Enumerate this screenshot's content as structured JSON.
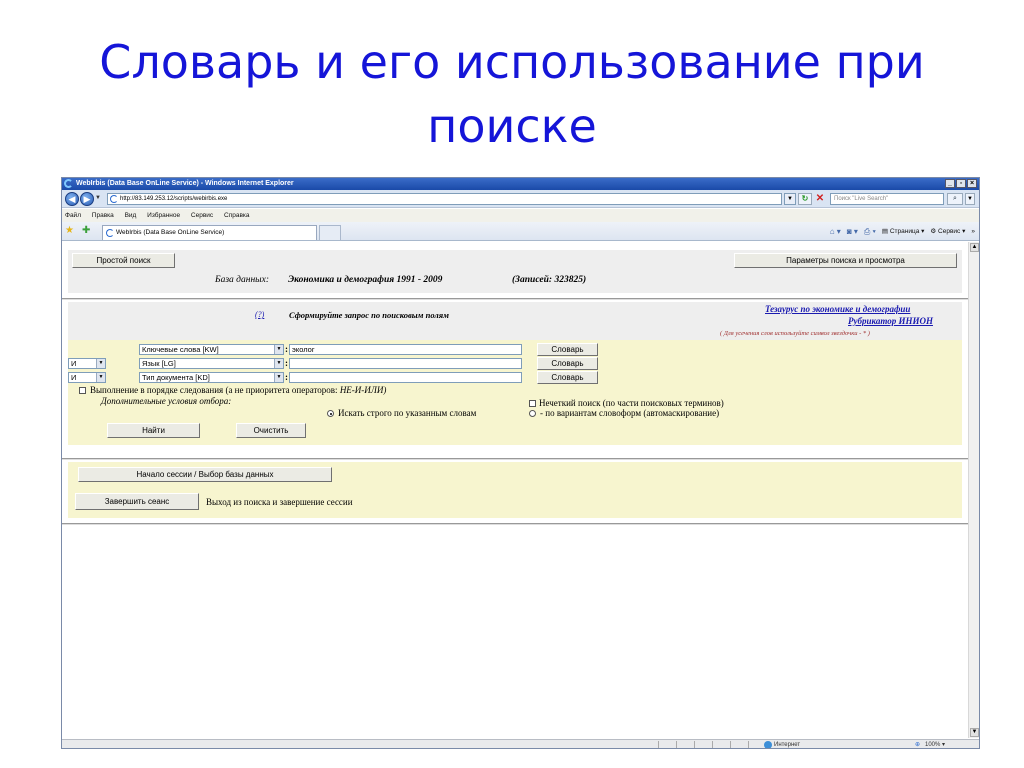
{
  "slide": {
    "title_line1": "Словарь и его использование при",
    "title_line2": "поиске"
  },
  "browser": {
    "window_title": "WebIrbis (Data Base OnLine Service) - Windows Internet Explorer",
    "address": "http://83.149.253.12/scripts/webirbis.exe",
    "search_placeholder": "Поиск \"Live Search\"",
    "menu": [
      "Файл",
      "Правка",
      "Вид",
      "Избранное",
      "Сервис",
      "Справка"
    ],
    "tab_title": "WebIrbis (Data Base OnLine Service)",
    "commands": {
      "page": "Страница",
      "tools": "Сервис"
    },
    "status": {
      "zone": "Интернет",
      "zoom": "100%"
    }
  },
  "page": {
    "simple_search_button": "Простой поиск",
    "params_button": "Параметры поиска и просмотра",
    "db_label": "База данных:",
    "db_name": "Экономика и демография 1991 - 2009",
    "db_count": "(Записей: 323825)",
    "help_link": "(?)",
    "form_heading": "Сформируйте запрос по поисковым полям",
    "thesaurus_link": "Тезаурус по экономике и демографии",
    "rubricator_link": "Рубрикатор ИНИОН",
    "truncation_note": "( Для усечения слов используйте символ звездочки - * )",
    "rows": [
      {
        "operator": "",
        "field": "Ключевые слова [KW]",
        "value": "эколог",
        "dict_button": "Словарь"
      },
      {
        "operator": "И",
        "field": "Язык [LG]",
        "value": "",
        "dict_button": "Словарь"
      },
      {
        "operator": "И",
        "field": "Тип документа [KD]",
        "value": "",
        "dict_button": "Словарь"
      }
    ],
    "order_checkbox_label": "Выполнение в порядке следования (а не приоритета операторов:",
    "order_checkbox_ops": "НЕ-И-ИЛИ)",
    "extra_conditions_label": "Дополнительные условия отбора:",
    "fuzzy_checkbox_label": "Нечеткий поиск (по части поисковых терминов)",
    "radio_strict_label": "Искать строго по указанным словам",
    "radio_variants_label": "- по вариантам словоформ (автомаскирование)",
    "find_button": "Найти",
    "clear_button": "Очистить",
    "session_start_button": "Начало сессии / Выбор базы данных",
    "end_session_button": "Завершить сеанс",
    "end_session_text": "Выход из поиска и завершение сессии"
  }
}
